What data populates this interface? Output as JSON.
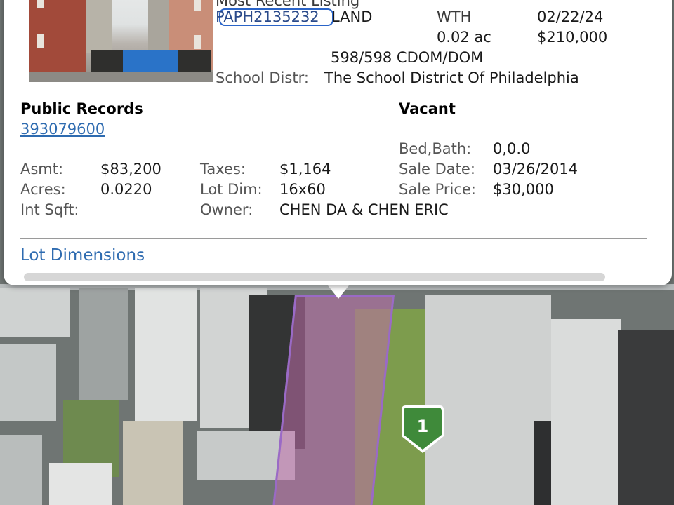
{
  "listing": {
    "header_partial": "Most Recent Listing",
    "mls_id": "PAPH2135232",
    "type": "LAND",
    "status": "WTH",
    "date": "02/22/24",
    "acres": "0.02 ac",
    "price": "$210,000",
    "dom": "598/598 CDOM/DOM",
    "school_label": "School Distr:",
    "school_value": "The School District Of Philadelphia"
  },
  "public_records": {
    "title": "Public Records",
    "parcel_id": "393079600",
    "status": "Vacant",
    "bed_bath_label": "Bed,Bath:",
    "bed_bath_value": "0,0.0",
    "asmt_label": "Asmt:",
    "asmt_value": "$83,200",
    "taxes_label": "Taxes:",
    "taxes_value": "$1,164",
    "sale_date_label": "Sale Date:",
    "sale_date_value": "03/26/2014",
    "acres_label": "Acres:",
    "acres_value": "0.0220",
    "lot_dim_label": "Lot Dim:",
    "lot_dim_value": "16x60",
    "sale_price_label": "Sale Price:",
    "sale_price_value": "$30,000",
    "int_sqft_label": "Int Sqft:",
    "owner_label": "Owner:",
    "owner_value": "CHEN DA & CHEN ERIC"
  },
  "lot_dimensions_link": "Lot Dimensions",
  "map": {
    "marker_label": "1",
    "marker_color": "#3f8a3a",
    "parcel_color": "#9a6ac6"
  }
}
